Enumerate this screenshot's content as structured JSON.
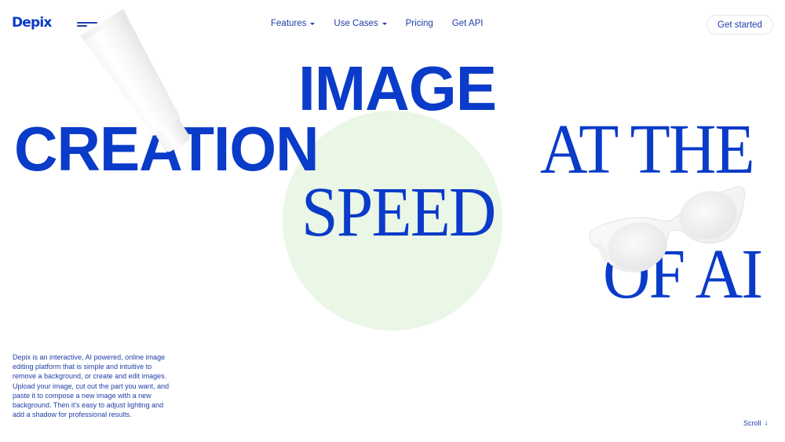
{
  "header": {
    "logo": "Depix",
    "menu_icon": "hamburger-menu-icon",
    "nav": [
      {
        "label": "Features",
        "has_dropdown": true
      },
      {
        "label": "Use Cases",
        "has_dropdown": true
      },
      {
        "label": "Pricing",
        "has_dropdown": false
      },
      {
        "label": "Get API",
        "has_dropdown": false
      }
    ],
    "cta_label": "Get started"
  },
  "hero": {
    "words": {
      "image": "IMAGE",
      "creation": "CREATION",
      "speed": "SPEED",
      "at_the": "AT THE",
      "of_ai": "OF AI"
    },
    "decorations": [
      "cosmetic-tube",
      "sunglasses",
      "green-circle"
    ]
  },
  "description": "Depix is an interactive, AI powered, online image editing platform that is simple and intuitive to remove a background, or create and edit images. Upload your image, cut out the part you want, and paste it to compose a new image with a new background. Then it's easy to adjust lighting and add a shadow for professional results.",
  "scroll": {
    "label": "Scroll",
    "icon": "arrow-down-icon"
  },
  "colors": {
    "brand": "#0a3bc9",
    "nav_text": "#1f3ea8",
    "circle": "#eaf6e6",
    "background": "#ffffff"
  }
}
